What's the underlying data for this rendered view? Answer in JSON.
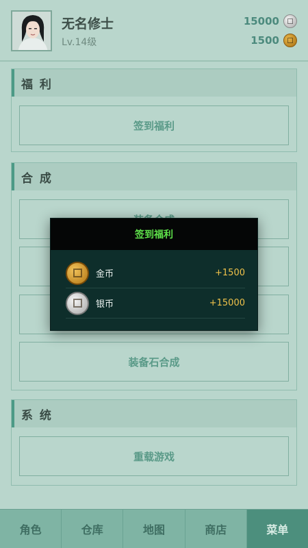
{
  "player": {
    "name": "无名修士",
    "level": "Lv.14级"
  },
  "currency": {
    "silver": "15000",
    "gold": "1500"
  },
  "sections": {
    "welfare": {
      "title": "福 利",
      "buttons": [
        "签到福利"
      ]
    },
    "synthesis": {
      "title": "合 成",
      "buttons": [
        "装备合成",
        "",
        "",
        "装备石合成"
      ]
    },
    "system": {
      "title": "系 统",
      "buttons": [
        "重载游戏"
      ]
    }
  },
  "bottom_nav": {
    "tabs": [
      "角色",
      "仓库",
      "地图",
      "商店",
      "菜单"
    ],
    "active": "菜单"
  },
  "modal": {
    "title": "签到福利",
    "rewards": [
      {
        "name": "金币",
        "amount": "+1500",
        "icon": "gold-coin-icon"
      },
      {
        "name": "银币",
        "amount": "+15000",
        "icon": "silver-coin-icon"
      }
    ]
  },
  "colors": {
    "background": "#b9d6cc",
    "accent": "#4c9a86",
    "modal_bg": "#0e2e2b",
    "modal_title": "#5ee04a",
    "reward_amount": "#f0c24a"
  }
}
